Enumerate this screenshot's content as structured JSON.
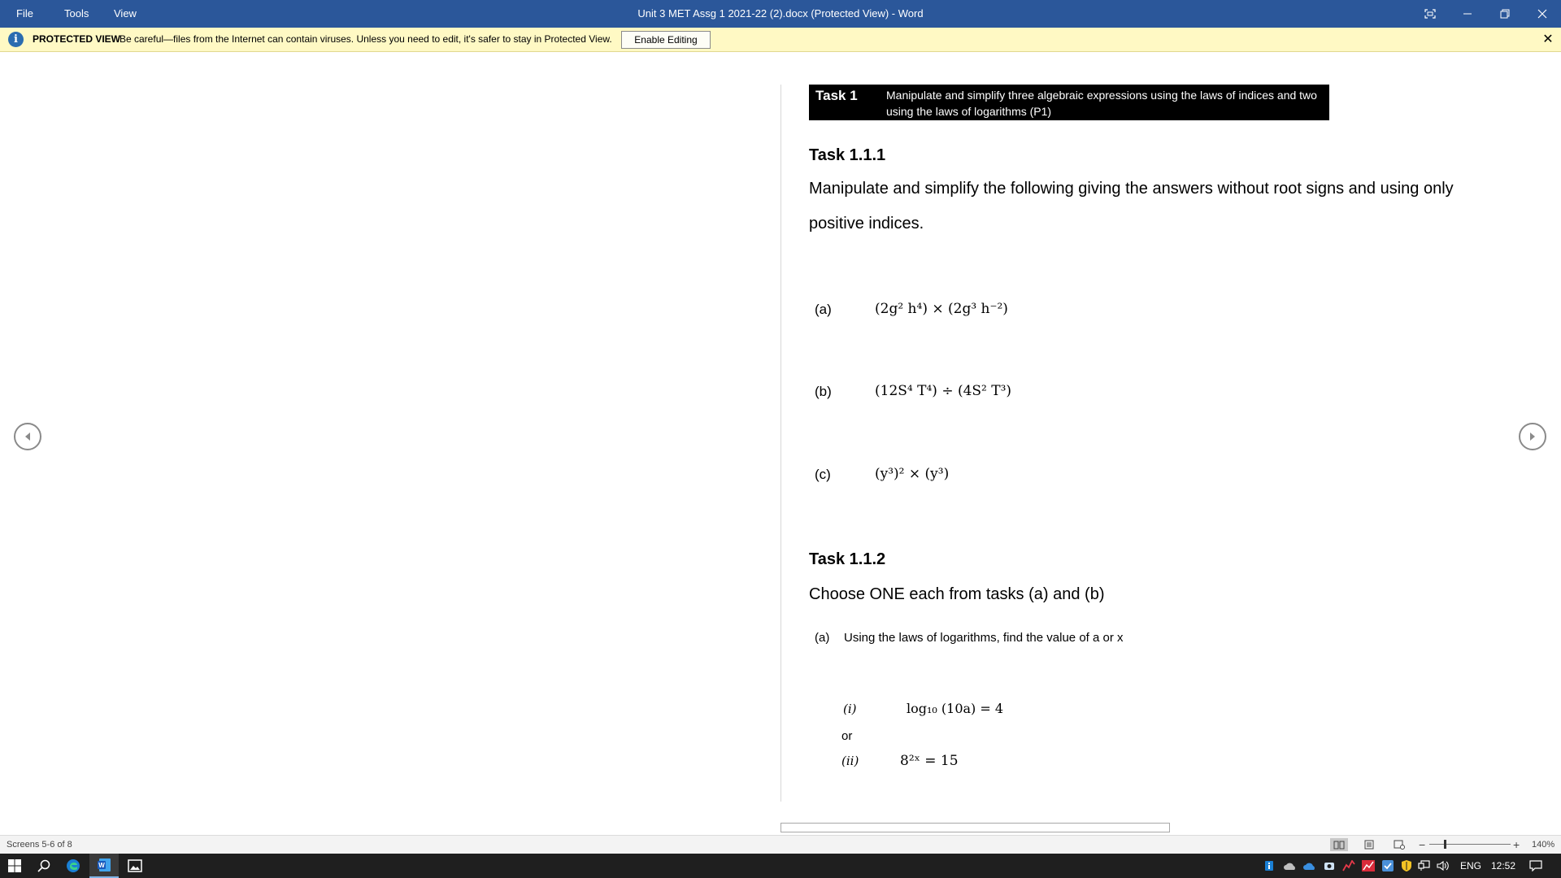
{
  "titlebar": {
    "menu": [
      "File",
      "Tools",
      "View"
    ],
    "title": "Unit 3 MET Assg 1 2021-22 (2).docx (Protected View) - Word"
  },
  "protected_bar": {
    "title": "PROTECTED VIEW",
    "message": "Be careful—files from the Internet can contain viruses. Unless you need to edit, it's safer to stay in Protected View.",
    "enable_button": "Enable Editing"
  },
  "document": {
    "banner_label": "Task 1",
    "banner_text": "Manipulate and simplify three algebraic expressions using the laws of indices and two using the laws of logarithms (P1)",
    "task111_heading": "Task 1.1.1",
    "task111_para_line1": "Manipulate and simplify the following giving the answers without root signs and using only",
    "task111_para_line2": "positive indices.",
    "items": [
      {
        "label": "(a)",
        "expr": "(2g²  h⁴) × (2g³  h⁻²)"
      },
      {
        "label": "(b)",
        "expr": "(12S⁴  T⁴) ÷ (4S²  T³)"
      },
      {
        "label": "(c)",
        "expr": "(y³)² × (y³)"
      }
    ],
    "task112_heading": "Task 1.1.2",
    "task112_para": "Choose ONE each from tasks (a) and (b)",
    "sub_a_label": "(a)",
    "sub_a_text": "Using the laws of logarithms, find the value of a or x",
    "log_items": [
      {
        "label": "(i)",
        "expr": "log₁₀ (10a) = 4"
      },
      {
        "label": "(ii)",
        "expr": "8²ˣ = 15"
      }
    ],
    "or_text": "or"
  },
  "statusbar": {
    "screens": "Screens 5-6 of 8",
    "zoom_minus": "−",
    "zoom_plus": "+",
    "zoom_level": "140%",
    "active_view": "read-mode"
  },
  "taskbar": {
    "lang": "ENG",
    "time": "12:52"
  },
  "colors": {
    "titlebar": "#2b579a",
    "protected_bar": "#fff9c4",
    "taskbar": "#1f1f1f"
  }
}
